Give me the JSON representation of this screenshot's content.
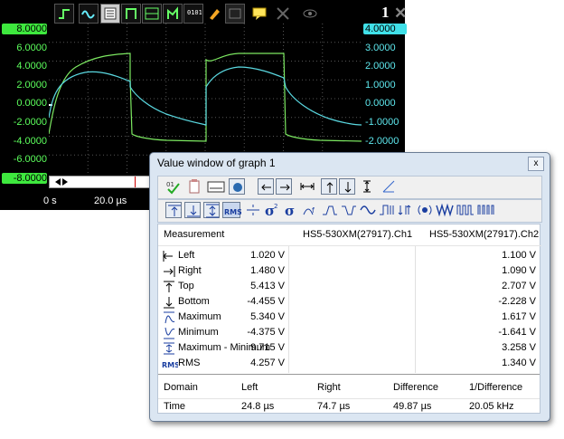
{
  "scope": {
    "graph_number": "1",
    "left_axis": [
      "8.0000",
      "6.0000",
      "4.0000",
      "2.0000",
      "0.0000",
      "-2.0000",
      "-4.0000",
      "-6.0000",
      "-8.0000"
    ],
    "right_axis": [
      "4.0000",
      "3.0000",
      "2.0000",
      "1.0000",
      "0.0000",
      "-1.0000",
      "-2.0000"
    ],
    "time_labels": [
      "0 s",
      "20.0 µs"
    ],
    "colors": {
      "ch1": "#7ce861",
      "ch2": "#5ad8e0",
      "left_axis_bg": "#3ee83e",
      "right_axis_bg": "#40e0e8"
    }
  },
  "value_window": {
    "title": "Value window of graph 1",
    "headers": {
      "measurement": "Measurement",
      "ch1": "HS5-530XM(27917).Ch1",
      "ch2": "HS5-530XM(27917).Ch2"
    },
    "rows": [
      {
        "label": "Left",
        "icon": "left-cursor-icon",
        "ch1": "1.020 V",
        "ch2": "1.100 V"
      },
      {
        "label": "Right",
        "icon": "right-cursor-icon",
        "ch1": "1.480 V",
        "ch2": "1.090 V"
      },
      {
        "label": "Top",
        "icon": "top-icon",
        "ch1": "5.413 V",
        "ch2": "2.707 V"
      },
      {
        "label": "Bottom",
        "icon": "bottom-icon",
        "ch1": "-4.455 V",
        "ch2": "-2.228 V"
      },
      {
        "label": "Maximum",
        "icon": "maximum-icon",
        "ch1": "5.340 V",
        "ch2": "1.617 V"
      },
      {
        "label": "Minimum",
        "icon": "minimum-icon",
        "ch1": "-4.375 V",
        "ch2": "-1.641 V"
      },
      {
        "label": "Maximum - Minimum",
        "icon": "max-min-icon",
        "ch1": "9.715 V",
        "ch2": "3.258 V"
      },
      {
        "label": "RMS",
        "icon": "rms-icon",
        "ch1": "4.257 V",
        "ch2": "1.340 V"
      }
    ],
    "domain": {
      "headers": [
        "Domain",
        "Left",
        "Right",
        "Difference",
        "1/Difference"
      ],
      "values": [
        "Time",
        "24.8 µs",
        "74.7 µs",
        "49.87 µs",
        "20.05 kHz"
      ]
    },
    "rms_label": "RMS",
    "close": "x"
  }
}
